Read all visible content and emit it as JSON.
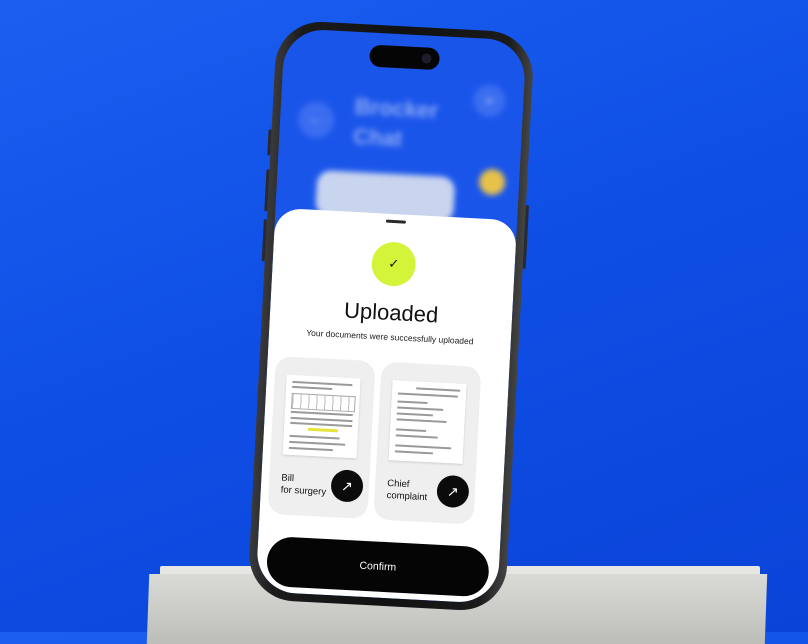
{
  "background": {
    "color": "#1556ec"
  },
  "phone": {
    "background_app": {
      "back_icon": "back-arrow-icon",
      "plus_icon": "plus-icon",
      "title": "Brocker Chat"
    },
    "sheet": {
      "check_icon": "checkmark-icon",
      "check_color": "#d4f43a",
      "title": "Uploaded",
      "subtitle": "Your documents were successfully uploaded",
      "documents": [
        {
          "label": "Bill for surgery",
          "label_line1": "Bill",
          "label_line2": "for surgery",
          "icon": "arrow-up-right-icon"
        },
        {
          "label": "Chief complaint",
          "label_line1": "Chief",
          "label_line2": "complaint",
          "icon": "arrow-up-right-icon"
        }
      ],
      "confirm_label": "Confirm"
    }
  }
}
